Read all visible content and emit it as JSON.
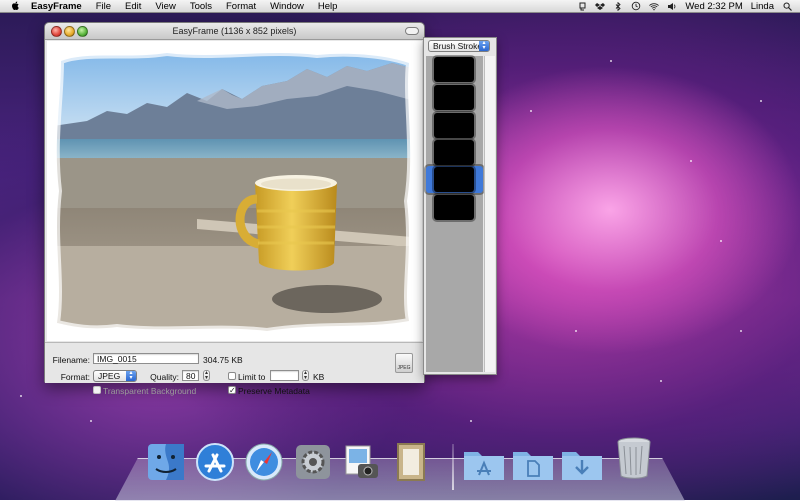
{
  "menubar": {
    "app_name": "EasyFrame",
    "items": [
      "File",
      "Edit",
      "View",
      "Tools",
      "Format",
      "Window",
      "Help"
    ],
    "clock": "Wed 2:32 PM",
    "user": "Linda"
  },
  "window": {
    "title": "EasyFrame (1136 x 852 pixels)"
  },
  "export": {
    "filename_label": "Filename:",
    "filename_value": "IMG_0015",
    "file_size": "304.75 KB",
    "format_label": "Format:",
    "format_value": "JPEG",
    "quality_label": "Quality:",
    "quality_value": "80",
    "limit_label": "Limit to",
    "limit_value": "",
    "limit_unit": "KB",
    "transparent_label": "Transparent Background",
    "transparent_checked": false,
    "preserve_label": "Preserve Metadata",
    "preserve_checked": true,
    "export_icon_text": "JPEG"
  },
  "frames_panel": {
    "category": "Brush Strokes",
    "thumbnail_count": 6,
    "selected_index": 4
  },
  "dock": {
    "apps": [
      {
        "name": "Finder",
        "icon": "finder-icon"
      },
      {
        "name": "App Store",
        "icon": "app-store-icon"
      },
      {
        "name": "Safari",
        "icon": "safari-icon"
      },
      {
        "name": "System Preferences",
        "icon": "system-preferences-icon"
      },
      {
        "name": "iPhoto",
        "icon": "iphoto-icon"
      },
      {
        "name": "EasyFrame",
        "icon": "easyframe-icon"
      },
      {
        "name": "Applications",
        "icon": "applications-folder-icon"
      },
      {
        "name": "Documents",
        "icon": "documents-folder-icon"
      },
      {
        "name": "Downloads",
        "icon": "downloads-folder-icon"
      },
      {
        "name": "Trash",
        "icon": "trash-icon"
      }
    ]
  }
}
